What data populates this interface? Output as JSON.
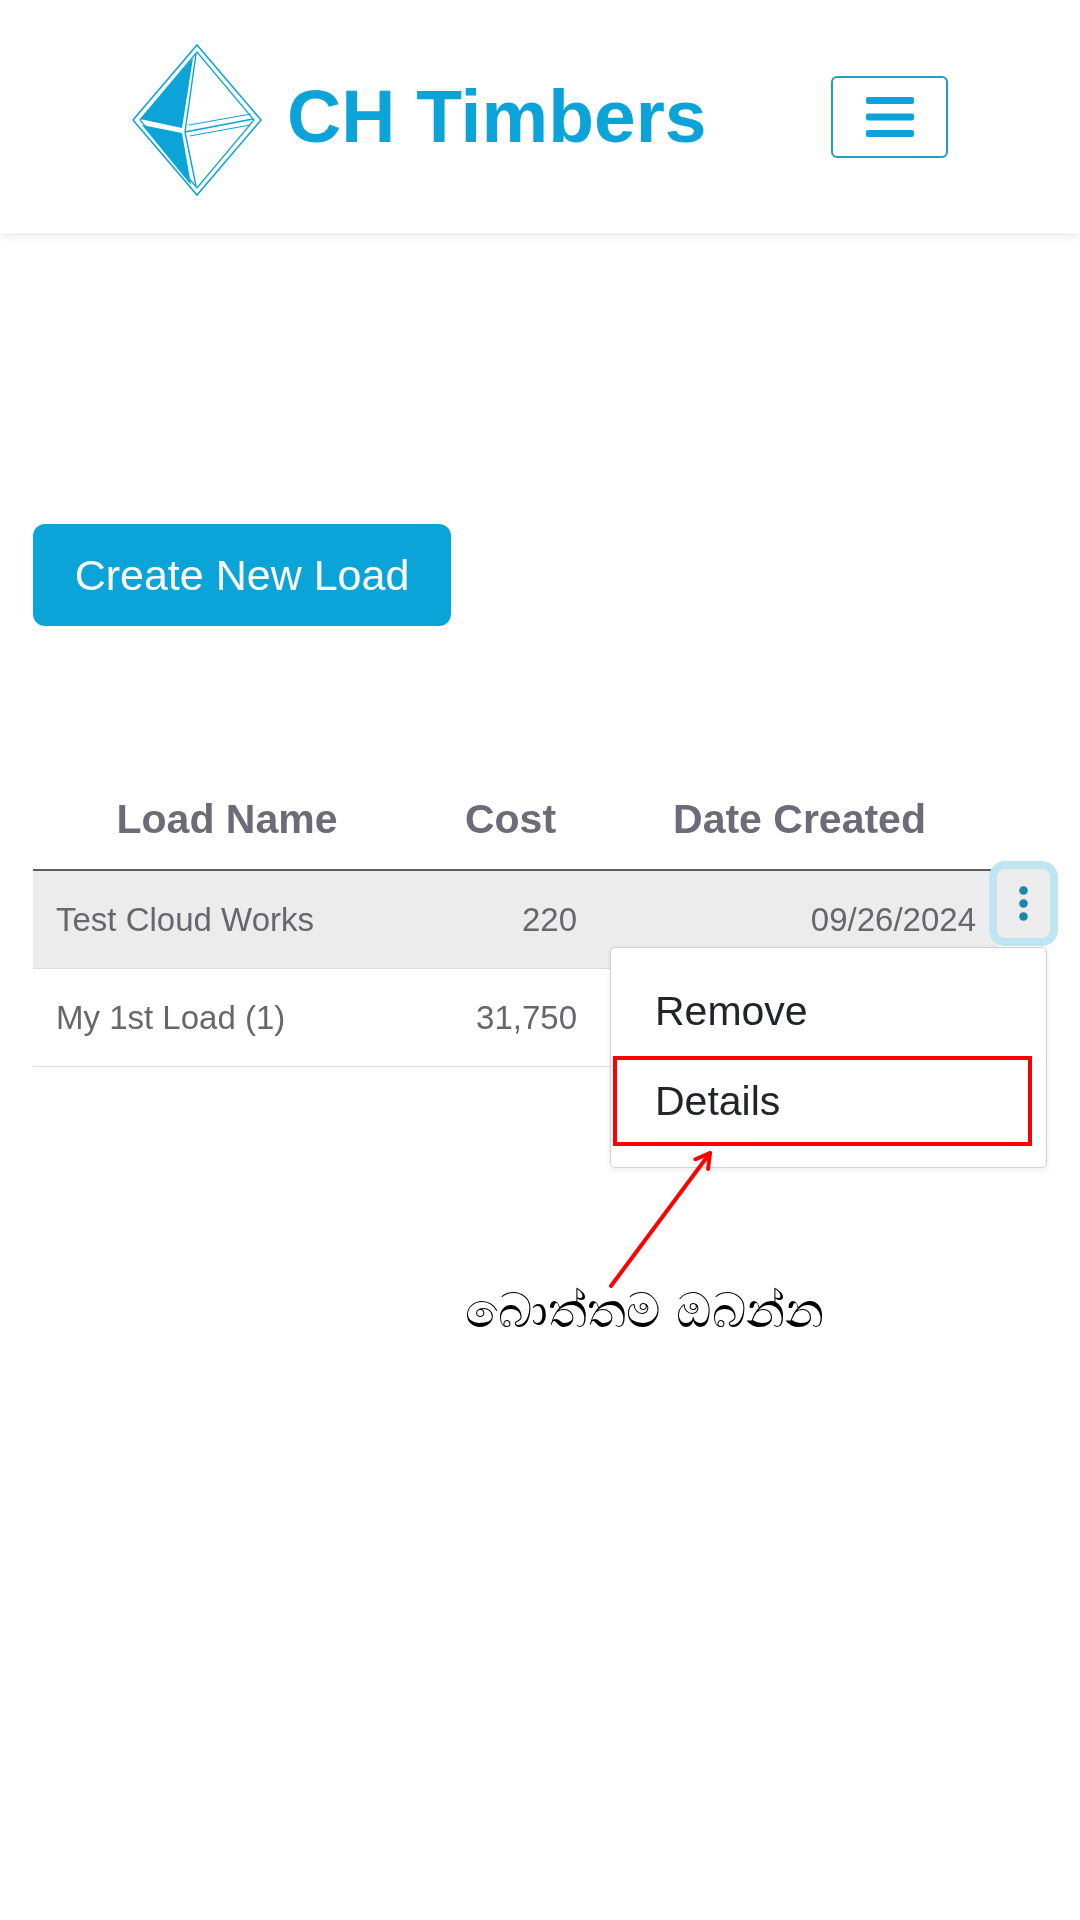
{
  "header": {
    "brand": "CH Timbers"
  },
  "create_button": {
    "label": "Create New Load"
  },
  "table": {
    "columns": [
      "Load Name",
      "Cost",
      "Date Created"
    ],
    "rows": [
      {
        "cells": [
          "Test Cloud Works",
          "220",
          "09/26/2024"
        ],
        "selected": true,
        "menu": {
          "items": [
            {
              "label": "Remove",
              "highlighted": false
            },
            {
              "label": "Details",
              "highlighted": true
            }
          ]
        }
      },
      {
        "cells": [
          "My 1st Load (1)",
          "31,750"
        ],
        "selected": false
      }
    ]
  },
  "annotation": {
    "text": "බොත්තම ඔබන්න"
  }
}
